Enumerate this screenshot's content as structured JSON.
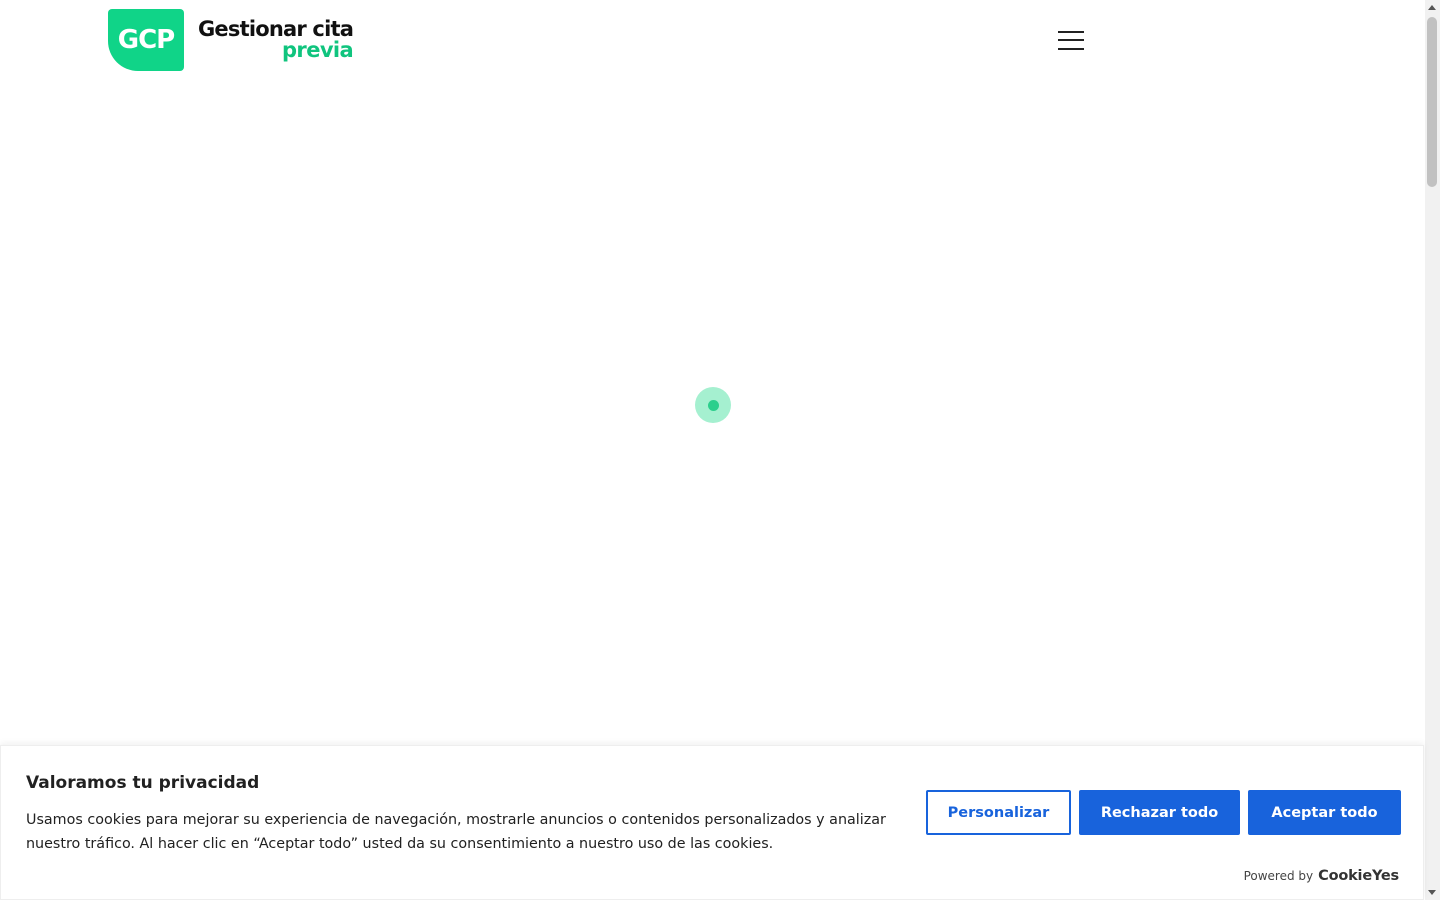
{
  "header": {
    "logo_mark": "GCP",
    "logo_line1": "Gestionar cita",
    "logo_line2": "previa",
    "menu_label": "menu-icon"
  },
  "loader": {
    "icon": "spinner-icon",
    "colors": {
      "outer": "#a5f0d0",
      "inner": "#2ccf8c"
    }
  },
  "cookie_banner": {
    "title": "Valoramos tu privacidad",
    "description": "Usamos cookies para mejorar su experiencia de navegación, mostrarle anuncios o contenidos personalizados y analizar nuestro tráfico. Al hacer clic en “Aceptar todo” usted da su consentimiento a nuestro uso de las cookies.",
    "customize_label": "Personalizar",
    "reject_label": "Rechazar todo",
    "accept_label": "Aceptar todo",
    "powered_by": "Powered by",
    "brand": "CookieYes"
  },
  "colors": {
    "brand_green": "#10d488",
    "button_blue": "#1863dc"
  }
}
